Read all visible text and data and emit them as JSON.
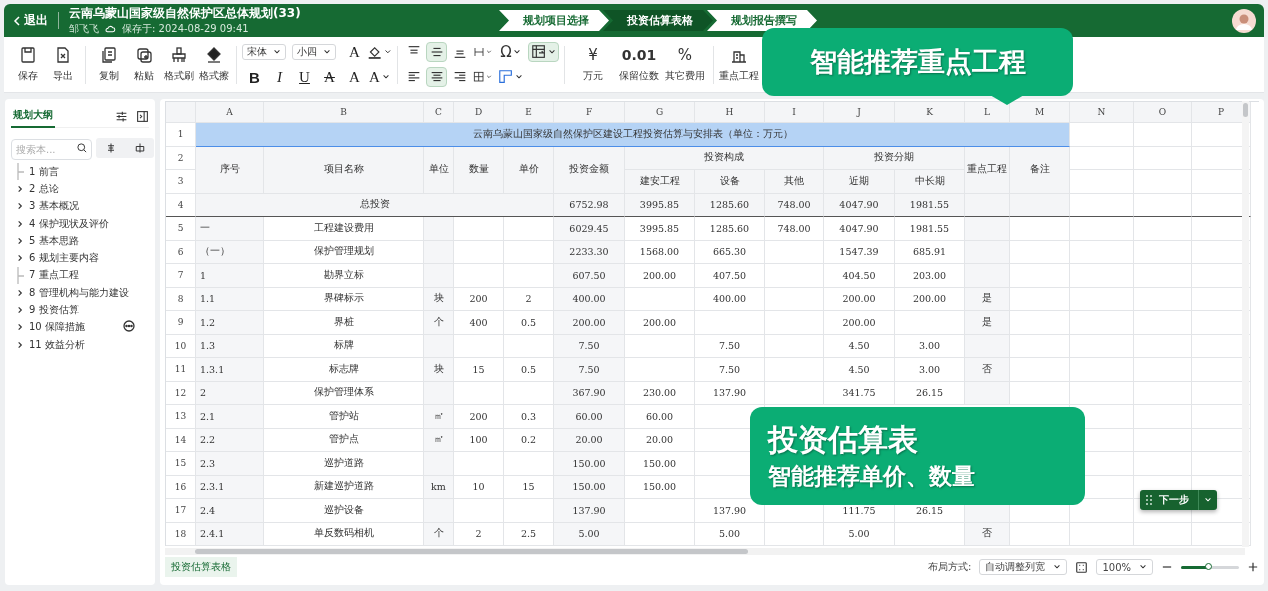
{
  "topbar": {
    "back": "退出",
    "title": "云南乌蒙山国家级自然保护区总体规划(33)",
    "author": "邹飞飞",
    "saved": "保存于: 2024-08-29 09:41",
    "steps": [
      {
        "label": "规划项目选择",
        "selected": false
      },
      {
        "label": "投资估算表格",
        "selected": true
      },
      {
        "label": "规划报告撰写",
        "selected": false
      }
    ]
  },
  "toolbar": {
    "file_actions": [
      {
        "kind": "save",
        "label": "保存"
      },
      {
        "kind": "export",
        "label": "导出"
      }
    ],
    "clipboard_actions": [
      {
        "kind": "copy",
        "label": "复制"
      },
      {
        "kind": "paste",
        "label": "粘贴"
      },
      {
        "kind": "brush",
        "label": "格式刷"
      },
      {
        "kind": "eraser",
        "label": "格式擦"
      }
    ],
    "font_family": "宋体",
    "font_size": "小四",
    "style_buttons": [
      {
        "kind": "grow",
        "glyph": "A"
      },
      {
        "kind": "fill"
      },
      {
        "kind": "bold",
        "glyph": "B"
      },
      {
        "kind": "italic",
        "glyph": "I"
      },
      {
        "kind": "underline",
        "glyph": "U"
      },
      {
        "kind": "strike",
        "glyph": "A"
      },
      {
        "kind": "grow",
        "glyph": "A"
      },
      {
        "kind": "color",
        "glyph": "A"
      }
    ],
    "align_buttons": [
      {
        "kind": "top",
        "selected": false
      },
      {
        "kind": "middle",
        "selected": true
      },
      {
        "kind": "bottom",
        "selected": false
      },
      {
        "kind": "merge",
        "selected": false
      },
      {
        "kind": "symbol",
        "glyph": "Ω",
        "selected": false
      },
      {
        "kind": "wrap",
        "selected": true
      },
      {
        "kind": "left",
        "selected": false
      },
      {
        "kind": "center",
        "selected": true
      },
      {
        "kind": "right",
        "selected": false
      },
      {
        "kind": "border",
        "selected": false
      },
      {
        "kind": "freeze",
        "selected": false
      }
    ],
    "number_actions": [
      {
        "glyph": "¥",
        "label": "万元"
      },
      {
        "glyph": "0.01",
        "label": "保留位数"
      },
      {
        "glyph": "%",
        "label": "其它费用"
      }
    ],
    "key_project": "重点工程"
  },
  "outline": {
    "tab": "规划大纲",
    "search_placeholder": "搜索本...",
    "items": [
      {
        "label": "1 前言",
        "kind": "leaf",
        "more": false
      },
      {
        "label": "2 总论",
        "kind": "branch",
        "more": false
      },
      {
        "label": "3 基本概况",
        "kind": "branch",
        "more": false
      },
      {
        "label": "4 保护现状及评价",
        "kind": "branch",
        "more": false
      },
      {
        "label": "5 基本思路",
        "kind": "branch",
        "more": false
      },
      {
        "label": "6 规划主要内容",
        "kind": "branch",
        "more": false
      },
      {
        "label": "7 重点工程",
        "kind": "leaf",
        "more": false
      },
      {
        "label": "8 管理机构与能力建设",
        "kind": "branch",
        "more": false
      },
      {
        "label": "9 投资估算",
        "kind": "branch",
        "more": false
      },
      {
        "label": "10 保障措施",
        "kind": "branch",
        "more": true
      },
      {
        "label": "11 效益分析",
        "kind": "branch",
        "more": false
      }
    ]
  },
  "sheet": {
    "columns": [
      "A",
      "B",
      "C",
      "D",
      "E",
      "F",
      "G",
      "H",
      "I",
      "J",
      "K",
      "L",
      "M",
      "N",
      "O",
      "P"
    ],
    "title_row": "1",
    "title": "云南乌蒙山国家级自然保护区建设工程投资估算与安排表（单位：万元）",
    "header_rows": [
      "2",
      "3"
    ],
    "header": {
      "seq": "序号",
      "name": "项目名称",
      "unit": "单位",
      "qty": "数量",
      "price": "单价",
      "amount": "投资金额",
      "composition": "投资构成",
      "phases": "投资分期",
      "construction": "建安工程",
      "equipment": "设备",
      "other": "其他",
      "near": "近期",
      "long": "中长期",
      "key": "重点工程",
      "note": "备注"
    },
    "total_row": {
      "num": "4",
      "label": "总投资",
      "values": [
        "6752.98",
        "3995.85",
        "1285.60",
        "748.00",
        "4047.90",
        "1981.55"
      ]
    },
    "rows": [
      {
        "num": "5",
        "cells": [
          "一",
          "工程建设费用",
          null,
          null,
          null,
          "6029.45",
          "3995.85",
          "1285.60",
          "748.00",
          "4047.90",
          "1981.55",
          null,
          null
        ]
      },
      {
        "num": "6",
        "cells": [
          "（一）",
          "保护管理规划",
          null,
          null,
          null,
          "2233.30",
          "1568.00",
          "665.30",
          null,
          "1547.39",
          "685.91",
          null,
          null
        ]
      },
      {
        "num": "7",
        "cells": [
          "1",
          "勘界立标",
          null,
          null,
          null,
          "607.50",
          "200.00",
          "407.50",
          null,
          "404.50",
          "203.00",
          null,
          null
        ]
      },
      {
        "num": "8",
        "cells": [
          "1.1",
          "界碑标示",
          "块",
          "200",
          "2",
          "400.00",
          null,
          "400.00",
          null,
          "200.00",
          "200.00",
          "是",
          null
        ]
      },
      {
        "num": "9",
        "cells": [
          "1.2",
          "界桩",
          "个",
          "400",
          "0.5",
          "200.00",
          "200.00",
          null,
          null,
          "200.00",
          null,
          "是",
          null
        ]
      },
      {
        "num": "10",
        "cells": [
          "1.3",
          "标牌",
          null,
          null,
          null,
          "7.50",
          null,
          "7.50",
          null,
          "4.50",
          "3.00",
          null,
          null
        ]
      },
      {
        "num": "11",
        "cells": [
          "1.3.1",
          "标志牌",
          "块",
          "15",
          "0.5",
          "7.50",
          null,
          "7.50",
          null,
          "4.50",
          "3.00",
          "否",
          null
        ]
      },
      {
        "num": "12",
        "cells": [
          "2",
          "保护管理体系",
          null,
          null,
          null,
          "367.90",
          "230.00",
          "137.90",
          null,
          "341.75",
          "26.15",
          null,
          null
        ]
      },
      {
        "num": "13",
        "cells": [
          "2.1",
          "管护站",
          "㎡",
          "200",
          "0.3",
          "60.00",
          "60.00",
          null,
          null,
          null,
          null,
          null,
          null
        ]
      },
      {
        "num": "14",
        "cells": [
          "2.2",
          "管护点",
          "㎡",
          "100",
          "0.2",
          "20.00",
          "20.00",
          null,
          null,
          null,
          null,
          null,
          null
        ]
      },
      {
        "num": "15",
        "cells": [
          "2.3",
          "巡护道路",
          null,
          null,
          null,
          "150.00",
          "150.00",
          null,
          null,
          null,
          null,
          null,
          null
        ]
      },
      {
        "num": "16",
        "cells": [
          "2.3.1",
          "新建巡护道路",
          "km",
          "10",
          "15",
          "150.00",
          "150.00",
          null,
          null,
          null,
          null,
          null,
          null
        ]
      },
      {
        "num": "17",
        "cells": [
          "2.4",
          "巡护设备",
          null,
          null,
          null,
          "137.90",
          null,
          "137.90",
          null,
          "111.75",
          "26.15",
          null,
          null
        ]
      },
      {
        "num": "18",
        "cells": [
          "2.4.1",
          "单反数码相机",
          "个",
          "2",
          "2.5",
          "5.00",
          null,
          "5.00",
          null,
          "5.00",
          null,
          "否",
          null
        ]
      }
    ]
  },
  "footer": {
    "sheet_tabs": [
      {
        "label": "投资估算表格",
        "selected": true
      }
    ],
    "layout_label": "布局方式:",
    "layout_value": "自动调整列宽",
    "zoom_value": "100%",
    "zoom": {
      "level": 0.48
    }
  },
  "callouts": [
    {
      "lines": [
        "智能推荐重点工程"
      ]
    },
    {
      "lines": [
        "投资估算表",
        "智能推荐单价、数量"
      ]
    }
  ],
  "next_button": "下一步"
}
